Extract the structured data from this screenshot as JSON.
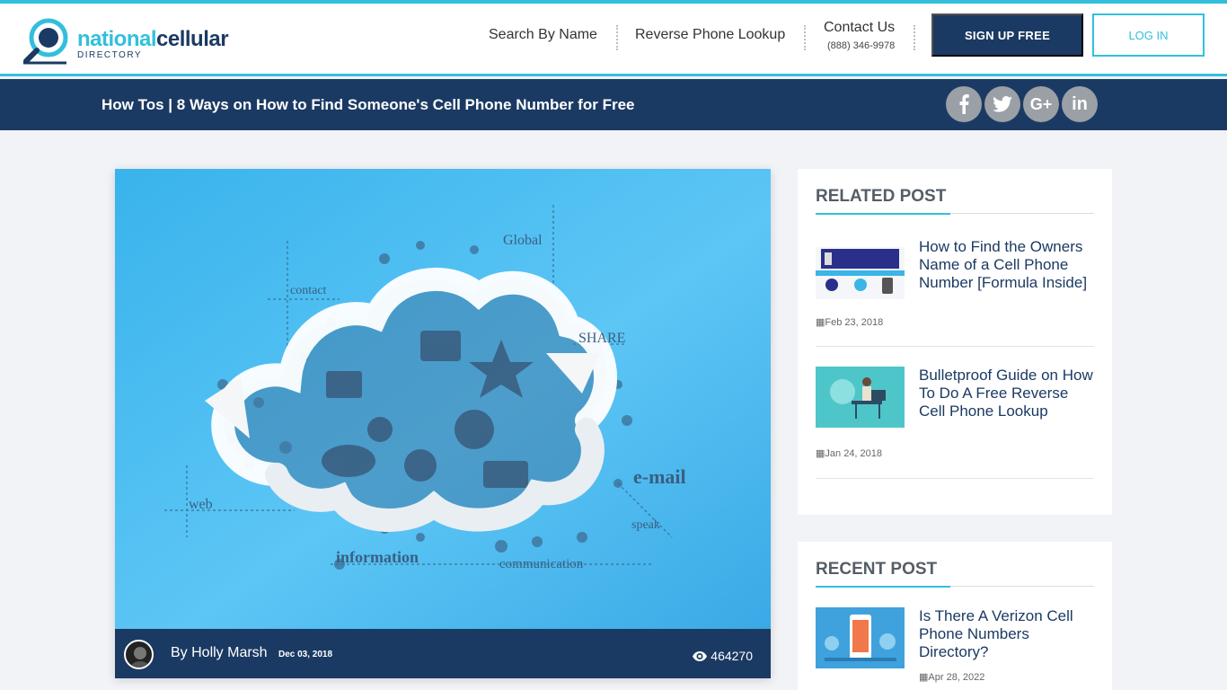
{
  "brand": {
    "name_part1": "national",
    "name_part2": "cellular",
    "subtitle": "DIRECTORY"
  },
  "nav": {
    "search_by_name": "Search By Name",
    "reverse_phone_lookup": "Reverse Phone Lookup",
    "contact_us": "Contact Us",
    "contact_phone": "(888) 346-9978",
    "signup": "SIGN UP FREE",
    "login": "LOG IN"
  },
  "titlebar": {
    "title": "How Tos | 8 Ways on How to Find Someone's Cell Phone Number for Free",
    "social": [
      "facebook-icon",
      "twitter-icon",
      "google-plus-icon",
      "linkedin-icon"
    ]
  },
  "article": {
    "hero_words": {
      "global": "Global",
      "contact": "contact",
      "share": "SHARE",
      "email": "e-mail",
      "web": "web",
      "speak": "speak",
      "information": "information",
      "communication": "communication"
    },
    "author": "By Holly Marsh",
    "date": "Dec 03, 2018",
    "views": "464270"
  },
  "related": {
    "heading": "RELATED POST",
    "posts": [
      {
        "title": "How to Find the Owners Name of a Cell Phone Number [Formula Inside]",
        "date": "Feb 23, 2018"
      },
      {
        "title": "Bulletproof Guide on How To Do A Free Reverse Cell Phone Lookup",
        "date": "Jan 24, 2018"
      }
    ]
  },
  "recent": {
    "heading": "RECENT POST",
    "posts": [
      {
        "title": "Is There A Verizon Cell Phone Numbers Directory?",
        "date": "Apr 28, 2022"
      }
    ]
  },
  "colors": {
    "accent": "#33bfdc",
    "navy": "#1b3a63",
    "background": "#f1f3f7",
    "social_gray": "#9aa0a6"
  }
}
